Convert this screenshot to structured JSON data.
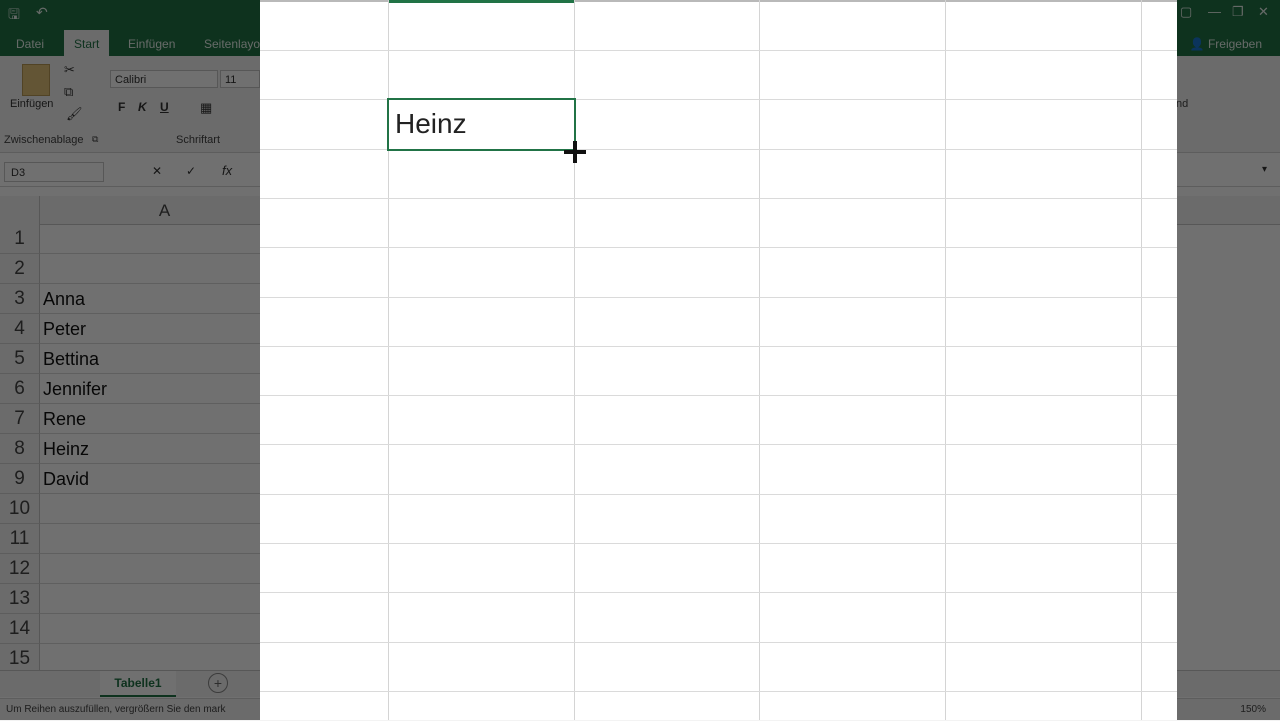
{
  "quick_access": {
    "save": "🖫",
    "undo": "↶"
  },
  "ribbon_tabs": [
    "Datei",
    "Start",
    "Einfügen",
    "Seitenlayo"
  ],
  "share_label": "Freigeben",
  "ribbon": {
    "paste_label": "Einfügen",
    "font_name": "Calibri",
    "font_size": "11",
    "bold": "F",
    "italic": "K",
    "underline": "U",
    "clipboard_group": "Zwischenablage",
    "font_group": "Schriftart",
    "right_partial": "nd"
  },
  "name_box": "D3",
  "column_header": "A",
  "rows": [
    {
      "num": "1",
      "value": ""
    },
    {
      "num": "2",
      "value": ""
    },
    {
      "num": "3",
      "value": "Anna"
    },
    {
      "num": "4",
      "value": "Peter"
    },
    {
      "num": "5",
      "value": "Bettina"
    },
    {
      "num": "6",
      "value": "Jennifer"
    },
    {
      "num": "7",
      "value": "Rene"
    },
    {
      "num": "8",
      "value": "Heinz"
    },
    {
      "num": "9",
      "value": "David"
    },
    {
      "num": "10",
      "value": ""
    },
    {
      "num": "11",
      "value": ""
    },
    {
      "num": "12",
      "value": ""
    },
    {
      "num": "13",
      "value": ""
    },
    {
      "num": "14",
      "value": ""
    },
    {
      "num": "15",
      "value": ""
    }
  ],
  "sheet_tab": "Tabelle1",
  "status_text": "Um Reihen auszufüllen, vergrößern Sie den mark",
  "zoom_level": "150%",
  "zoomed_cell_text": "Heinz",
  "colors": {
    "accent": "#217346",
    "dim_overlay": "rgba(0,0,0,0.56)"
  }
}
